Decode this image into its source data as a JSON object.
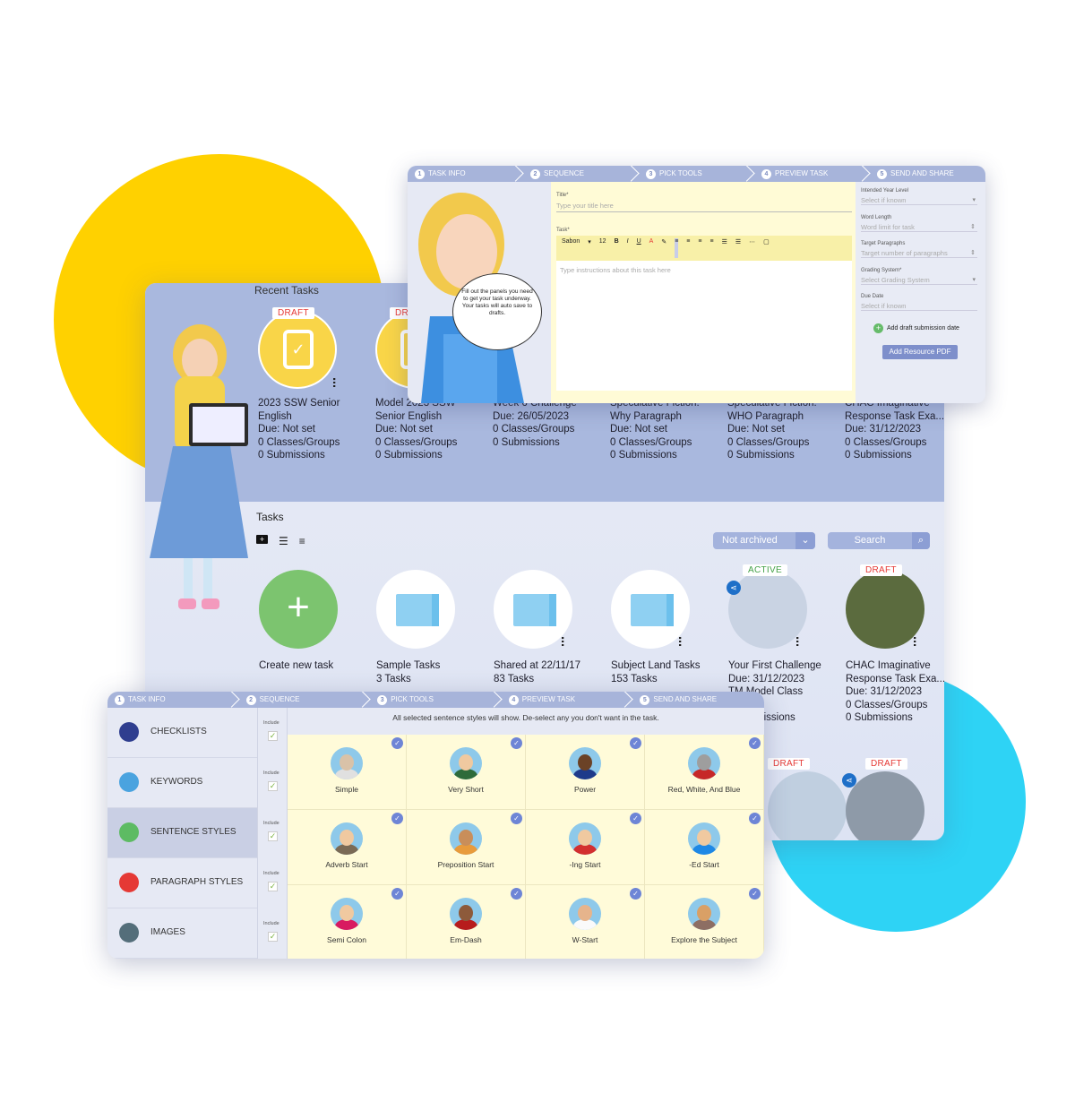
{
  "colors": {
    "yellow": "#FFD100",
    "cyan": "#2ED3F5",
    "panel": "#A9B8DE",
    "green": "#7CC46F",
    "draft": "#E53935",
    "active": "#43A047"
  },
  "recent": {
    "title": "Recent Tasks",
    "cards": [
      {
        "badge": "DRAFT",
        "lines": [
          "2023 SSW Senior",
          "English",
          "Due: Not set",
          "0 Classes/Groups",
          "0 Submissions"
        ]
      },
      {
        "badge": "DRAFT",
        "lines": [
          "Model 2023 SSW",
          "Senior English",
          "Due: Not set",
          "0 Classes/Groups",
          "0 Submissions"
        ]
      },
      {
        "lines": [
          "Week 6 Challenge",
          "Due: 26/05/2023",
          "0 Classes/Groups",
          "0 Submissions",
          ""
        ]
      },
      {
        "lines": [
          "Speculative Fiction:",
          "Why Paragraph",
          "Due: Not set",
          "0 Classes/Groups",
          "0 Submissions"
        ]
      },
      {
        "lines": [
          "Speculative Fiction:",
          "WHO Paragraph",
          "Due: Not set",
          "0 Classes/Groups",
          "0 Submissions"
        ]
      },
      {
        "lines": [
          "CHAC Imaginative",
          "Response Task Exa...",
          "Due: 31/12/2023",
          "0 Classes/Groups",
          "0 Submissions"
        ]
      }
    ]
  },
  "tasks": {
    "title": "Tasks",
    "filter": "Not archived",
    "search_placeholder": "Search",
    "cards": [
      {
        "lines": [
          "Create new task",
          ""
        ]
      },
      {
        "lines": [
          "Sample Tasks",
          "3 Tasks"
        ]
      },
      {
        "lines": [
          "Shared at 22/11/17",
          "83 Tasks"
        ]
      },
      {
        "lines": [
          "Subject Land Tasks",
          "153 Tasks"
        ]
      },
      {
        "badge": "ACTIVE",
        "lines": [
          "Your First Challenge",
          "Due: 31/12/2023",
          "TM Model Class",
          "",
          "0 Submissions"
        ]
      },
      {
        "badge": "DRAFT",
        "lines": [
          "CHAC Imaginative",
          "Response Task Exa...",
          "Due: 31/12/2023",
          "0 Classes/Groups",
          "0 Submissions"
        ]
      }
    ],
    "row2_badges": [
      "DRAFT",
      "DRAFT"
    ]
  },
  "steps": [
    {
      "n": "1",
      "label": "TASK INFO"
    },
    {
      "n": "2",
      "label": "SEQUENCE"
    },
    {
      "n": "3",
      "label": "PICK TOOLS"
    },
    {
      "n": "4",
      "label": "PREVIEW TASK"
    },
    {
      "n": "5",
      "label": "SEND AND SHARE"
    }
  ],
  "task_info": {
    "bubble": "Fill out the panels you need to get your task underway. Your tasks will auto save to drafts.",
    "title_label": "Title*",
    "title_placeholder": "Type your title here",
    "task_label": "Task*",
    "font": "Sabon",
    "size": "12",
    "task_placeholder": "Type instructions about this task here",
    "fields": [
      {
        "label": "Intended Year Level",
        "placeholder": "Select if known",
        "arrow": "▾"
      },
      {
        "label": "Word Length",
        "placeholder": "Word limit for task",
        "arrow": "⇕"
      },
      {
        "label": "Target Paragraphs",
        "placeholder": "Target number of paragraphs",
        "arrow": "⇕"
      },
      {
        "label": "Grading System*",
        "placeholder": "Select Grading System",
        "arrow": "▾"
      },
      {
        "label": "Due Date",
        "placeholder": "Select if known",
        "arrow": ""
      }
    ],
    "add_draft": "Add draft submission date",
    "add_pdf": "Add Resource PDF"
  },
  "pick_tools": {
    "instruction": "All selected sentence styles will show. De-select any you don't want in the task.",
    "include_label": "Include",
    "sidebar": [
      {
        "label": "CHECKLISTS",
        "color": "#2F3E8F"
      },
      {
        "label": "KEYWORDS",
        "color": "#4AA3DF"
      },
      {
        "label": "SENTENCE STYLES",
        "color": "#5DBB63",
        "selected": true
      },
      {
        "label": "PARAGRAPH STYLES",
        "color": "#E53935"
      },
      {
        "label": "IMAGES",
        "color": "#546E7A"
      }
    ],
    "styles": [
      {
        "name": "Simple",
        "face": "#d9c2a8",
        "body": "#e0e0e0"
      },
      {
        "name": "Very Short",
        "face": "#f0c9a0",
        "body": "#2e6b3a"
      },
      {
        "name": "Power",
        "face": "#6b4226",
        "body": "#1e3a8a"
      },
      {
        "name": "Red, White, And Blue",
        "face": "#9e9e9e",
        "body": "#c62828"
      },
      {
        "name": "Adverb Start",
        "face": "#f0c9a0",
        "body": "#7a6a55"
      },
      {
        "name": "Preposition Start",
        "face": "#c98e5a",
        "body": "#e89b3c"
      },
      {
        "name": "-Ing Start",
        "face": "#f0c9a0",
        "body": "#d32f2f"
      },
      {
        "name": "-Ed Start",
        "face": "#f0c9a0",
        "body": "#1e88e5"
      },
      {
        "name": "Semi Colon",
        "face": "#f0c9a0",
        "body": "#d81b60"
      },
      {
        "name": "Em-Dash",
        "face": "#8d5a3b",
        "body": "#b71c1c"
      },
      {
        "name": "W-Start",
        "face": "#e6b48c",
        "body": "#fafafa"
      },
      {
        "name": "Explore the Subject",
        "face": "#d9a066",
        "body": "#8d6e63"
      }
    ]
  }
}
